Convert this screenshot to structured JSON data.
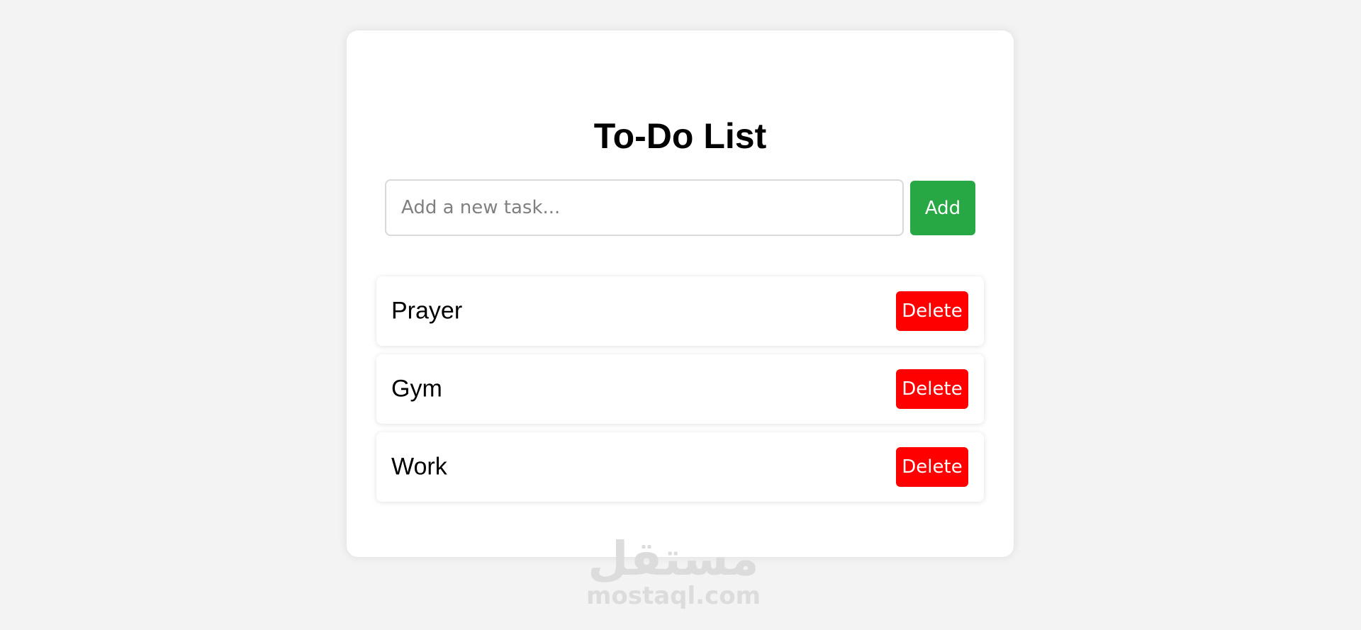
{
  "app": {
    "title": "To-Do List"
  },
  "new_task": {
    "placeholder": "Add a new task...",
    "value": "",
    "add_label": "Add"
  },
  "tasks": [
    {
      "text": "Prayer",
      "delete_label": "Delete"
    },
    {
      "text": "Gym",
      "delete_label": "Delete"
    },
    {
      "text": "Work",
      "delete_label": "Delete"
    }
  ],
  "watermark": {
    "logo_text": "مستقل",
    "url": "mostaql.com"
  },
  "colors": {
    "background": "#f3f3f3",
    "card": "#ffffff",
    "add_button": "#28a745",
    "delete_button": "#ff0000"
  }
}
